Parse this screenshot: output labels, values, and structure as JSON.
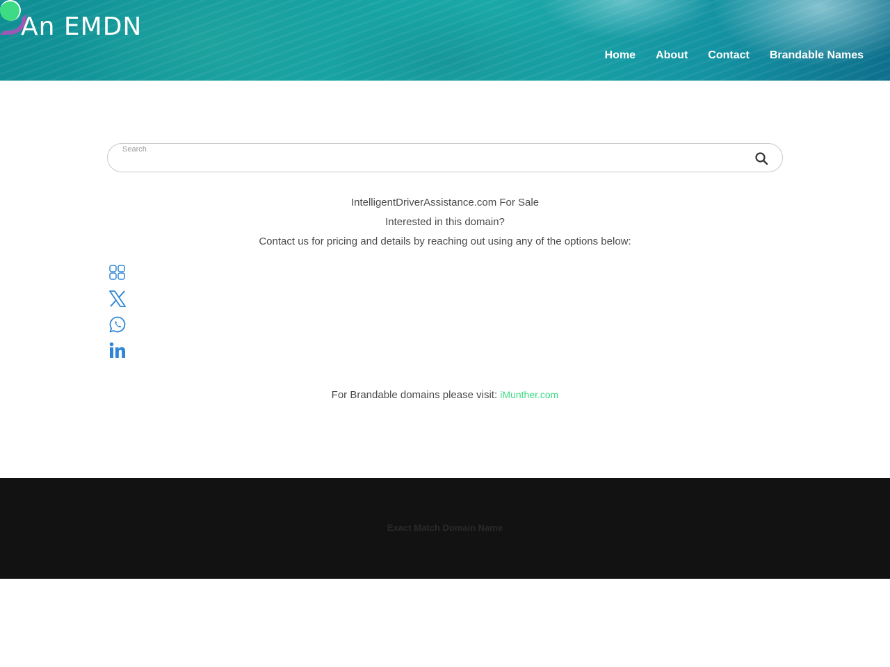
{
  "header": {
    "site_title": "An EMDN",
    "nav": [
      {
        "label": "Home"
      },
      {
        "label": "About"
      },
      {
        "label": "Contact"
      },
      {
        "label": "Brandable Names"
      }
    ]
  },
  "search": {
    "placeholder": "Search",
    "value": ""
  },
  "main": {
    "headline": "IntelligentDriverAssistance.com For Sale",
    "question": "Interested in this domain?",
    "cta": "Contact us for pricing and details by reaching out using any of the options below:",
    "socials": [
      {
        "icon": "grid-icon"
      },
      {
        "icon": "x-icon"
      },
      {
        "icon": "whatsapp-icon"
      },
      {
        "icon": "linkedin-icon"
      }
    ],
    "brandable_text": "For Brandable domains please visit:",
    "brandable_link": "iMunther.com"
  },
  "footer": {
    "text": "Exact Match Domain Name"
  },
  "colors": {
    "accent": "#3ddc84",
    "logo_purple": "#9b59b6",
    "social_blue": "#2f86d6",
    "footer_bg": "#121212"
  }
}
